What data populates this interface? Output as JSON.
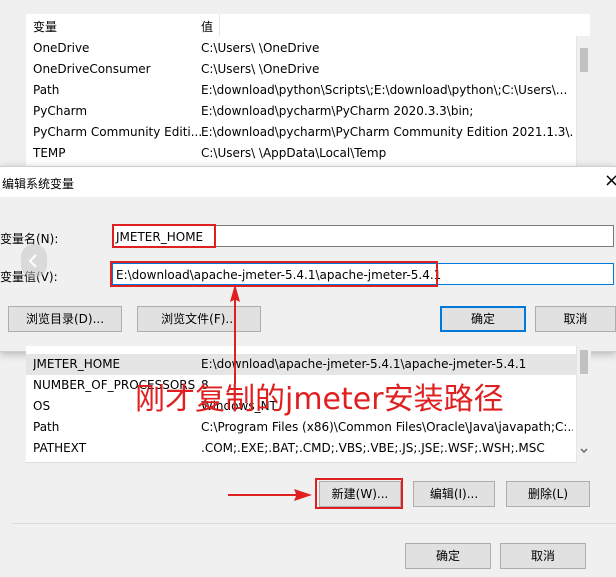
{
  "user_vars_table": {
    "headers": {
      "name": "变量",
      "value": "值"
    },
    "rows": [
      {
        "name": "OneDrive",
        "value": "C:\\Users\\      \\OneDrive"
      },
      {
        "name": "OneDriveConsumer",
        "value": "C:\\Users\\      \\OneDrive"
      },
      {
        "name": "Path",
        "value": "E:\\download\\python\\Scripts\\;E:\\download\\python\\;C:\\Users\\..."
      },
      {
        "name": "PyCharm",
        "value": "E:\\download\\pycharm\\PyCharm 2020.3.3\\bin;"
      },
      {
        "name": "PyCharm Community Editi...",
        "value": "E:\\download\\pycharm\\PyCharm Community Edition 2021.1.3\\..."
      },
      {
        "name": "TEMP",
        "value": "C:\\Users\\      \\AppData\\Local\\Temp"
      }
    ]
  },
  "edit_dialog": {
    "title": "编辑系统变量",
    "name_label": "变量名(N):",
    "name_value": "JMETER_HOME",
    "value_label": "变量值(V):",
    "value_value": "E:\\download\\apache-jmeter-5.4.1\\apache-jmeter-5.4.1",
    "browse_dir_button": "浏览目录(D)...",
    "browse_file_button": "浏览文件(F)...",
    "ok_button": "确定",
    "cancel_button": "取消",
    "close_glyph": "×"
  },
  "system_vars_table": {
    "rows": [
      {
        "name": "JMETER_HOME",
        "value": "E:\\download\\apache-jmeter-5.4.1\\apache-jmeter-5.4.1",
        "selected": true
      },
      {
        "name": "NUMBER_OF_PROCESSORS",
        "value": "8"
      },
      {
        "name": "OS",
        "value": "Windows_NT"
      },
      {
        "name": "Path",
        "value": "C:\\Program Files (x86)\\Common Files\\Oracle\\Java\\javapath;C:..."
      },
      {
        "name": "PATHEXT",
        "value": ".COM;.EXE;.BAT;.CMD;.VBS;.VBE;.JS;.JSE;.WSF;.WSH;.MSC"
      }
    ],
    "new_button": "新建(W)...",
    "edit_button": "编辑(I)...",
    "delete_button": "删除(L)"
  },
  "footer": {
    "ok_button": "确定",
    "cancel_button": "取消"
  },
  "annotation": {
    "text": "刚才复制的jmeter安装路径",
    "color": "#e02020"
  },
  "colors": {
    "highlight_red": "#e02020",
    "focus_blue": "#0078d7"
  }
}
